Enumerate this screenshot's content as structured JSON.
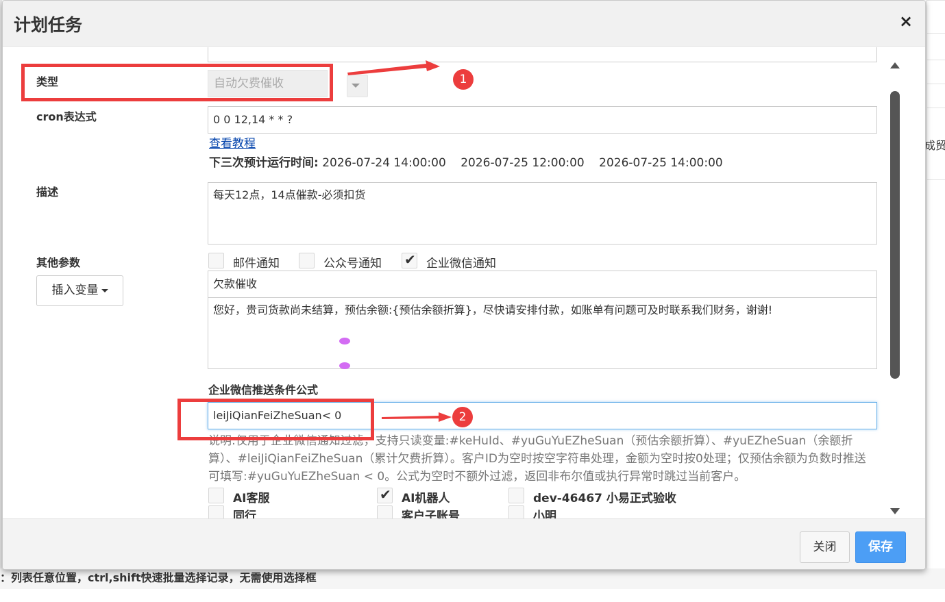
{
  "modal": {
    "title": "计划任务",
    "close_symbol": "×"
  },
  "form": {
    "type_label": "类型",
    "type_value": "自动欠费催收",
    "cron_label": "cron表达式",
    "cron_value": "0 0 12,14 * * ?",
    "tutorial_link": "查看教程",
    "next_runs_label": "下三次预计运行时间:",
    "next_runs": [
      "2026-07-24 14:00:00",
      "2026-07-25 12:00:00",
      "2026-07-25 14:00:00"
    ],
    "desc_label": "描述",
    "desc_value": "每天12点，14点催款-必须扣货",
    "other_params_label": "其他参数",
    "insert_var_button": "插入变量",
    "notify_options": [
      {
        "label": "邮件通知",
        "checked": false
      },
      {
        "label": "公众号通知",
        "checked": false
      },
      {
        "label": "企业微信通知",
        "checked": true
      }
    ],
    "msg_title": "欠款催收",
    "msg_body": "您好，贵司货款尚未结算，预估余额:{预估余额折算}，尽快请安排付款，如账单有问题可及时联系我们财务，谢谢!",
    "formula_label": "企业微信推送条件公式",
    "formula_value": "leiJiQianFeiZheSuan< 0",
    "help_text": "说明:仅用于企业微信通知过滤，支持只读变量:#keHuId、#yuGuYuEZheSuan（预估余额折算）、#yuEZheSuan（余额折算）、#leiJiQianFeiZheSuan（累计欠费折算）。客户ID为空时按空字符串处理，金额为空时按0处理；仅预估余额为负数时推送可填写:#yuGuYuEZheSuan < 0。公式为空时不额外过滤，返回非布尔值或执行异常时跳过当前客户。",
    "recipients": [
      {
        "label": "AI客服",
        "checked": false
      },
      {
        "label": "AI机器人",
        "checked": true
      },
      {
        "label": "dev-46467 小易正式验收",
        "checked": false
      },
      {
        "label": "同行",
        "checked": false
      },
      {
        "label": "客户子账号",
        "checked": false
      },
      {
        "label": "小明",
        "checked": false
      }
    ]
  },
  "footer": {
    "close_button": "关闭",
    "save_button": "保存"
  },
  "annotations": {
    "badge_1": "1",
    "badge_2": "2",
    "color": "#ec3d3d"
  },
  "background": {
    "tip": "：列表任意位置，ctrl,shift快速批量选择记录，无需使用选择框",
    "right_fragment": "成贸"
  }
}
